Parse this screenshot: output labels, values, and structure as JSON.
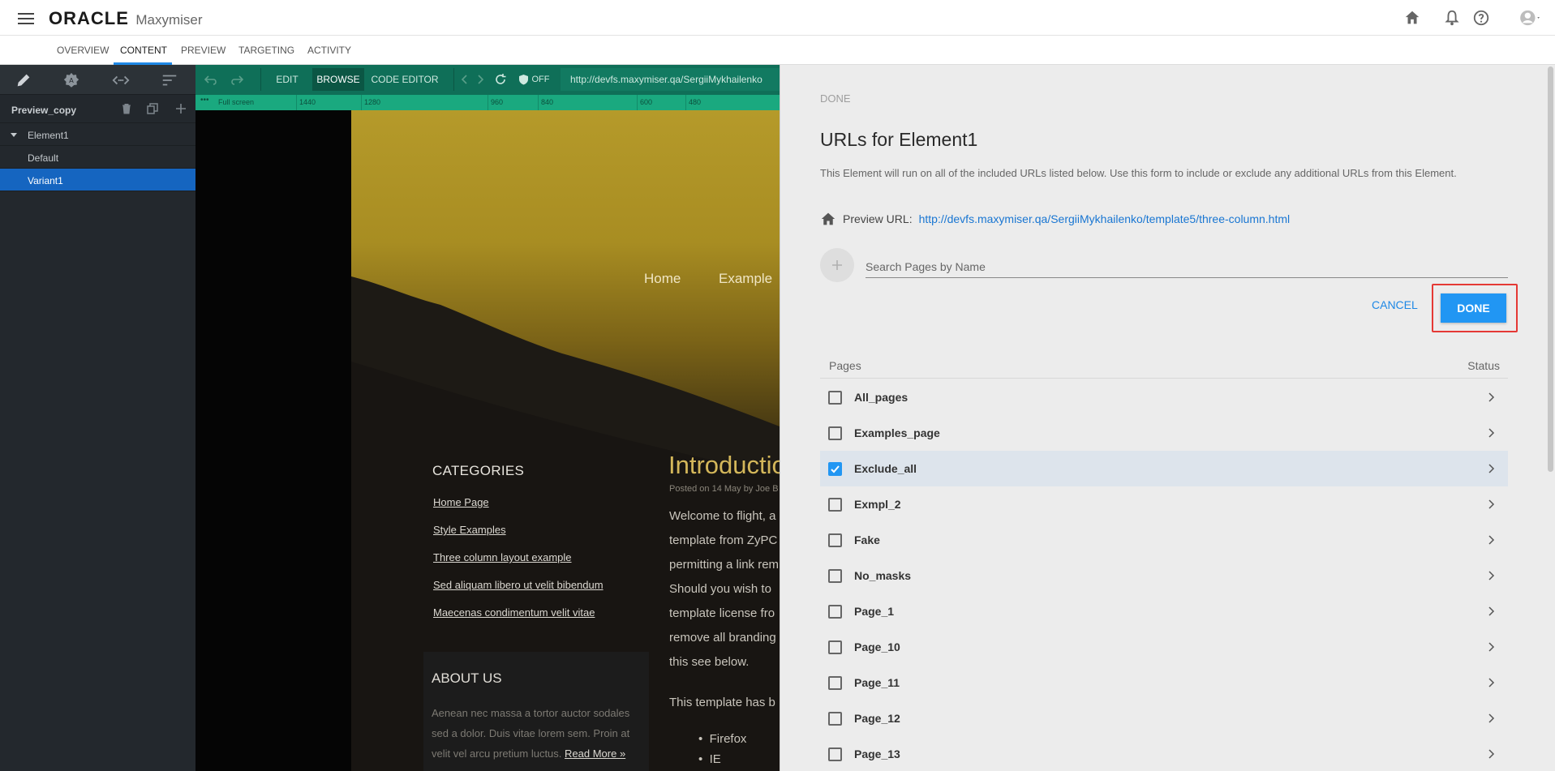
{
  "app": {
    "brand": "ORACLE",
    "product": "Maxymiser"
  },
  "nav_tabs": [
    "OVERVIEW",
    "CONTENT",
    "PREVIEW",
    "TARGETING",
    "ACTIVITY"
  ],
  "active_tab": "CONTENT",
  "sidebar": {
    "preview_name": "Preview_copy",
    "element_name": "Element1",
    "variants": [
      "Default",
      "Variant1"
    ],
    "selected_variant": "Variant1"
  },
  "editor_toolbar": {
    "edit_label": "EDIT",
    "browse_label": "BROWSE",
    "code_editor_label": "CODE EDITOR",
    "shield_label": "OFF",
    "url": "http://devfs.maxymiser.qa/SergiiMykhailenko"
  },
  "ruler": {
    "labels": [
      "Full screen",
      "1440",
      "1280",
      "960",
      "840",
      "600",
      "480"
    ]
  },
  "site_preview": {
    "nav_home": "Home",
    "nav_examples": "Example",
    "categories_title": "CATEGORIES",
    "category_links": [
      "Home Page",
      "Style Examples",
      "Three column layout example",
      "Sed aliquam libero ut velit bibendum",
      "Maecenas condimentum velit vitae"
    ],
    "intro_title": "Introductio",
    "intro_meta": "Posted on 14 May by Joe B",
    "intro_lines": [
      "Welcome to flight, a",
      "template from ZyPC",
      "permitting a link rem",
      "Should you wish to",
      "template license fro",
      "remove all branding",
      "this see below."
    ],
    "intro_para2": "This template has b",
    "bullets": [
      "Firefox",
      "IE"
    ],
    "about_title": "ABOUT US",
    "about_lines": [
      "Aenean nec massa a tortor auctor sodales",
      "sed a dolor. Duis vitae lorem sem. Proin at",
      "velit vel arcu pretium luctus."
    ],
    "read_more": "Read More »"
  },
  "panel": {
    "done_top": "DONE",
    "title": "URLs for Element1",
    "description": "This Element will run on all of the included URLs listed below. Use this form to include or exclude any additional URLs from this Element.",
    "preview_label": "Preview URL:",
    "preview_url": "http://devfs.maxymiser.qa/SergiiMykhailenko/template5/three-column.html",
    "search_placeholder": "Search Pages by Name",
    "cancel_label": "CANCEL",
    "done_label": "DONE",
    "col_pages": "Pages",
    "col_status": "Status",
    "pages": [
      {
        "name": "All_pages",
        "checked": false
      },
      {
        "name": "Examples_page",
        "checked": false
      },
      {
        "name": "Exclude_all",
        "checked": true
      },
      {
        "name": "Exmpl_2",
        "checked": false
      },
      {
        "name": "Fake",
        "checked": false
      },
      {
        "name": "No_masks",
        "checked": false
      },
      {
        "name": "Page_1",
        "checked": false
      },
      {
        "name": "Page_10",
        "checked": false
      },
      {
        "name": "Page_11",
        "checked": false
      },
      {
        "name": "Page_12",
        "checked": false
      },
      {
        "name": "Page_13",
        "checked": false
      }
    ]
  },
  "icons": {
    "home": "home-icon",
    "bell": "bell-icon",
    "help": "help-icon",
    "avatar": "user-avatar-icon"
  },
  "colors": {
    "accent": "#2196f3",
    "highlight": "#e53935",
    "editor_green": "#0f6f58",
    "selected_variant": "#1565c0"
  }
}
